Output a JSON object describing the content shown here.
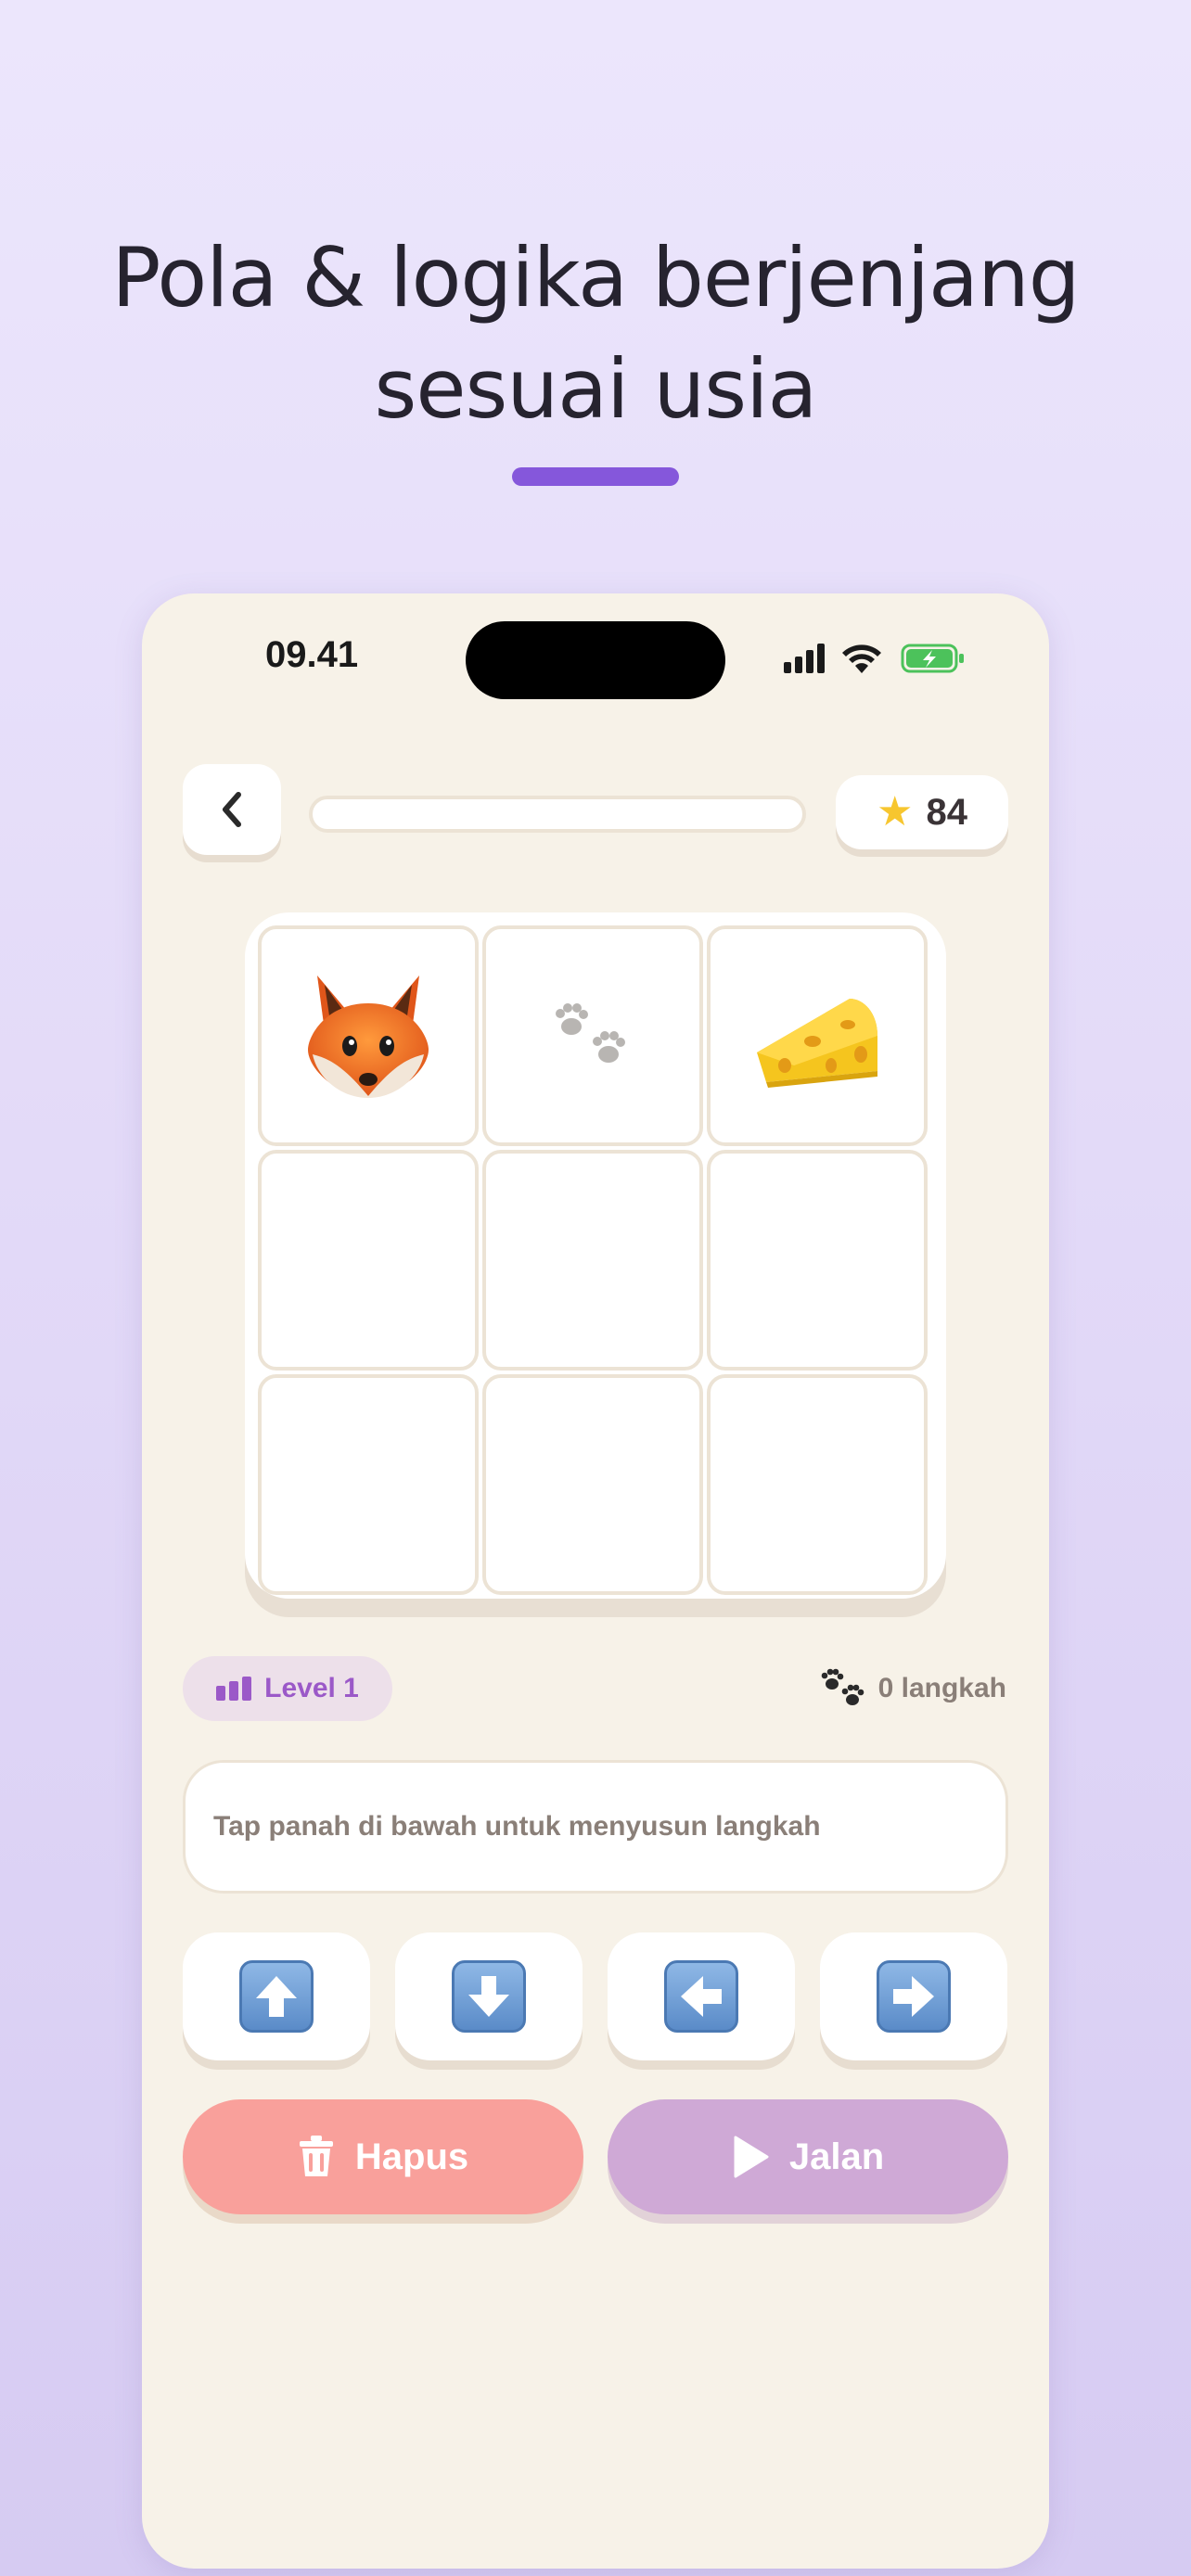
{
  "headline": {
    "line1": "Pola & logika berjenjang",
    "line2": "sesuai usia"
  },
  "status_bar": {
    "time": "09.41"
  },
  "header": {
    "back_icon": "chevron-left-icon",
    "progress": 0,
    "stars": "84",
    "star_icon": "star-icon"
  },
  "board": {
    "rows": 3,
    "cols": 3,
    "cells": [
      [
        "fox",
        "paw-prints",
        "cheese"
      ],
      [
        "",
        "",
        ""
      ],
      [
        "",
        "",
        ""
      ]
    ]
  },
  "info": {
    "level": "Level 1",
    "steps": "0 langkah"
  },
  "hint": "Tap panah di bawah untuk menyusun langkah",
  "controls": {
    "arrows": [
      "up-arrow-icon",
      "down-arrow-icon",
      "left-arrow-icon",
      "right-arrow-icon"
    ],
    "delete_label": "Hapus",
    "run_label": "Jalan"
  },
  "colors": {
    "accent": "#8557db",
    "delete": "#f9a09b",
    "run": "#cfa9d6",
    "phone_bg": "#f7f2e8"
  }
}
